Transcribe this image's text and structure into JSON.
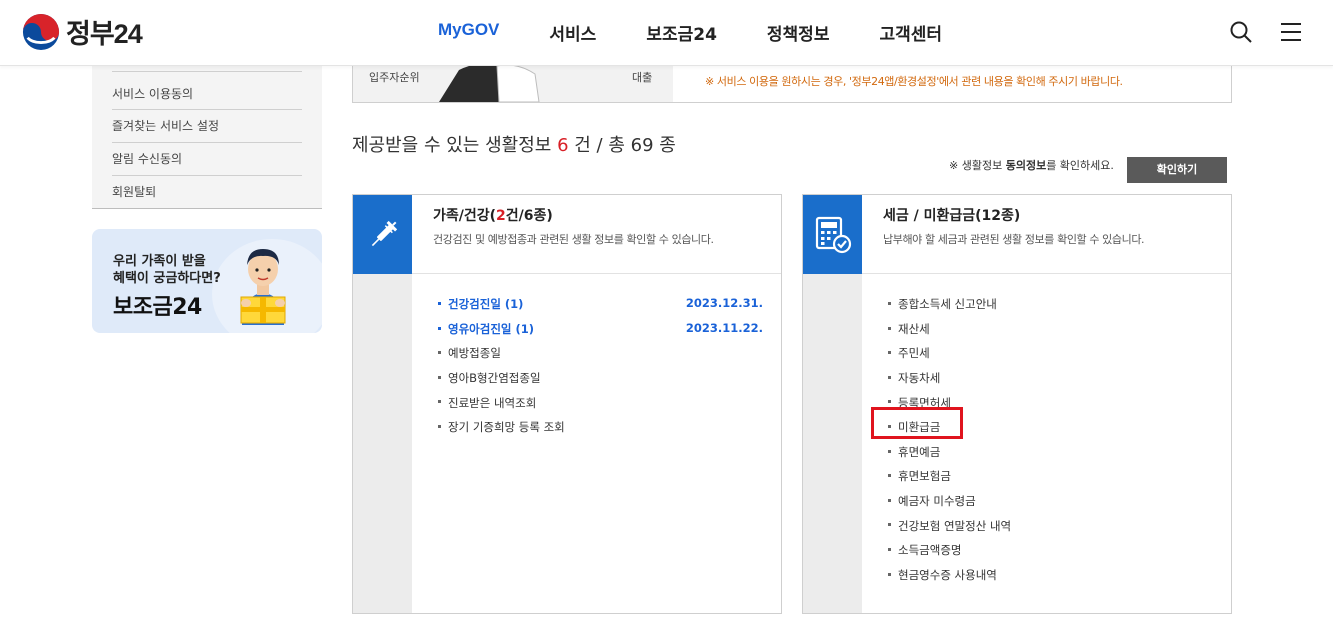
{
  "header": {
    "logo_text": "정부24",
    "nav": [
      "MyGOV",
      "서비스",
      "보조금24",
      "정책정보",
      "고객센터"
    ],
    "active_nav": "MyGOV",
    "icons": [
      "search-icon",
      "menu-icon"
    ]
  },
  "sidebar": {
    "links": [
      "서비스 이용동의",
      "즐겨찾는 서비스 설정",
      "알림 수신동의",
      "회원탈퇴"
    ],
    "banner": {
      "line1": "우리 가족이 받을",
      "line2": "혜택이 궁금하다면?",
      "title": "보조금24"
    }
  },
  "top_box": {
    "label_left": "입주자순위",
    "label_right": "대출",
    "note": "※ 서비스 이용을 원하시는 경우, '정부24앱/환경설정'에서 관련 내용을 확인해 주시기 바랍니다."
  },
  "summary": {
    "prefix": "제공받을 수 있는 생활정보",
    "count": "6",
    "mid": "건 / 총",
    "total": "69",
    "suffix": "종"
  },
  "consent": {
    "pre": "※ 생활정보",
    "bold": "동의정보",
    "post": "를 확인하세요.",
    "button": "확인하기"
  },
  "cards": [
    {
      "icon": "syringe-icon",
      "title_pre": "가족/건강(",
      "title_num": "2",
      "title_post": "건/6종)",
      "desc": "건강검진 및 예방접종과 관련된 생활 정보를 확인할 수 있습니다.",
      "items": [
        {
          "label": "건강검진일 (1)",
          "date": "2023.12.31."
        },
        {
          "label": "영유아검진일 (1)",
          "date": "2023.11.22."
        },
        {
          "label": "예방접종일"
        },
        {
          "label": "영아B형간염접종일"
        },
        {
          "label": "진료받은 내역조회"
        },
        {
          "label": "장기 기증희망 등록 조회"
        }
      ]
    },
    {
      "icon": "calculator-check-icon",
      "title": "세금 / 미환급금(12종)",
      "desc": "납부해야 할 세금과 관련된 생활 정보를 확인할 수 있습니다.",
      "items": [
        "종합소득세 신고안내",
        "재산세",
        "주민세",
        "자동차세",
        "등록면허세",
        "미환급금",
        "휴면예금",
        "휴면보험금",
        "예금자 미수령금",
        "건강보험 연말정산 내역",
        "소득금액증명",
        "현금영수증 사용내역"
      ]
    }
  ],
  "colors": {
    "brand_blue": "#1a6ecb",
    "active_nav": "#1a62d8",
    "highlight_red": "#d81f26",
    "note_orange": "#d2690e",
    "annotation_box": "#e0141e"
  }
}
